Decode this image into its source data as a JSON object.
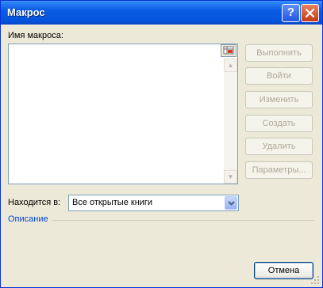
{
  "window": {
    "title": "Макрос",
    "help_glyph": "?"
  },
  "form": {
    "name_label": "Имя макроса:",
    "name_value": "",
    "location_label": "Находится в:",
    "location_value": "Все открытые книги",
    "description_label": "Описание"
  },
  "buttons": {
    "run": "Выполнить",
    "step_into": "Войти",
    "edit": "Изменить",
    "create": "Создать",
    "delete": "Удалить",
    "options": "Параметры...",
    "cancel": "Отмена"
  },
  "colors": {
    "titlebar": "#0553dc",
    "dialog_bg": "#ece9d8",
    "disabled_text": "#aca899",
    "link_blue": "#0046d5"
  }
}
